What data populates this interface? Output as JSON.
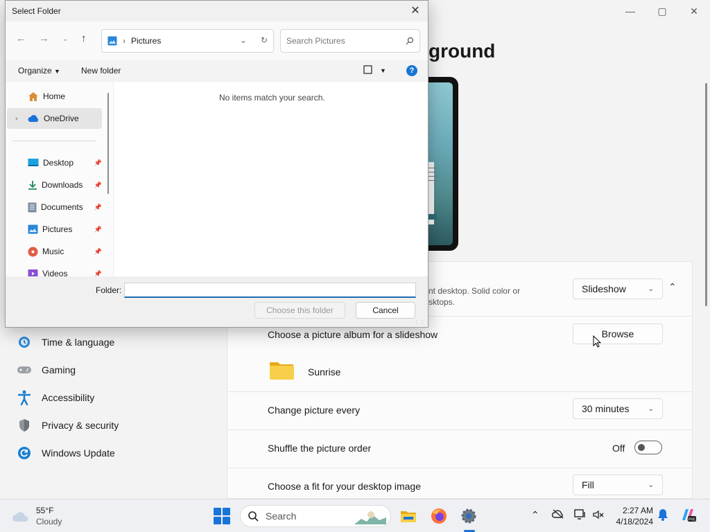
{
  "settings": {
    "page_title": "ground",
    "window_controls": [
      "—",
      "▢",
      "✕"
    ],
    "nav": [
      {
        "label": "Time & language",
        "icon": "clock-globe-icon"
      },
      {
        "label": "Gaming",
        "icon": "gamepad-icon"
      },
      {
        "label": "Accessibility",
        "icon": "accessibility-icon"
      },
      {
        "label": "Privacy & security",
        "icon": "shield-icon"
      },
      {
        "label": "Windows Update",
        "icon": "refresh-icon"
      }
    ],
    "personalize": {
      "desc_line1": "nt desktop. Solid color or",
      "desc_line2": "sktops.",
      "dropdown_value": "Slideshow"
    },
    "album": {
      "label": "Choose a picture album for a slideshow",
      "browse_label": "Browse",
      "folder_name": "Sunrise"
    },
    "change_every": {
      "label": "Change picture every",
      "value": "30 minutes"
    },
    "shuffle": {
      "label": "Shuffle the picture order",
      "state": "Off"
    },
    "fit": {
      "label": "Choose a fit for your desktop image",
      "value": "Fill"
    }
  },
  "dialog": {
    "title": "Select Folder",
    "address": "Pictures",
    "search_placeholder": "Search Pictures",
    "organize_label": "Organize",
    "new_folder_label": "New folder",
    "nav_items": [
      {
        "label": "Home",
        "icon": "home-icon",
        "pinned": false
      },
      {
        "label": "OneDrive",
        "icon": "cloud-icon",
        "pinned": false
      },
      {
        "label": "Desktop",
        "icon": "desktop-icon",
        "pinned": true
      },
      {
        "label": "Downloads",
        "icon": "download-icon",
        "pinned": true
      },
      {
        "label": "Documents",
        "icon": "document-icon",
        "pinned": true
      },
      {
        "label": "Pictures",
        "icon": "pictures-icon",
        "pinned": true
      },
      {
        "label": "Music",
        "icon": "music-icon",
        "pinned": true
      },
      {
        "label": "Videos",
        "icon": "video-icon",
        "pinned": true
      }
    ],
    "empty_message": "No items match your search.",
    "folder_label": "Folder:",
    "folder_value": "",
    "choose_label": "Choose this folder",
    "cancel_label": "Cancel"
  },
  "taskbar": {
    "temperature": "55°F",
    "condition": "Cloudy",
    "search_label": "Search",
    "time": "2:27 AM",
    "date": "4/18/2024"
  },
  "colors": {
    "accent": "#1a73d9",
    "folder": "#f5c542"
  }
}
